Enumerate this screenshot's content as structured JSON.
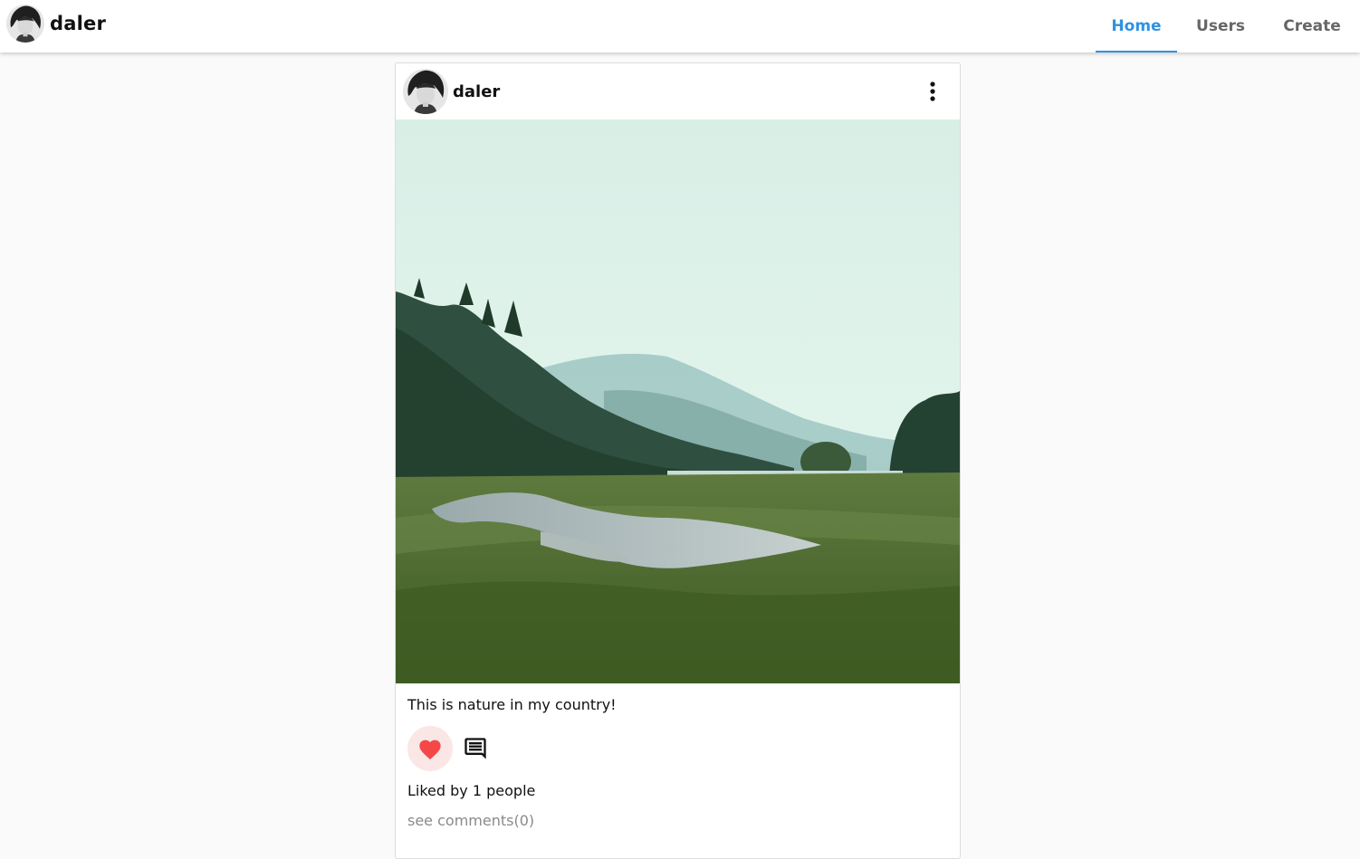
{
  "header": {
    "username": "daler",
    "tabs": [
      {
        "label": "Home",
        "active": true
      },
      {
        "label": "Users",
        "active": false
      },
      {
        "label": "Create",
        "active": false
      }
    ]
  },
  "post": {
    "username": "daler",
    "caption": "This is nature in my country!",
    "likes_text": "Liked by 1 people",
    "comments_link": "see comments(0)",
    "liked": true
  },
  "icons": {
    "more": "more-vert-icon",
    "like": "heart-icon",
    "comment": "comment-icon"
  },
  "colors": {
    "accent": "#2f92e0",
    "heart": "#f44848",
    "like_bg": "#fbe6e6",
    "muted_text": "#8a8a8a"
  }
}
